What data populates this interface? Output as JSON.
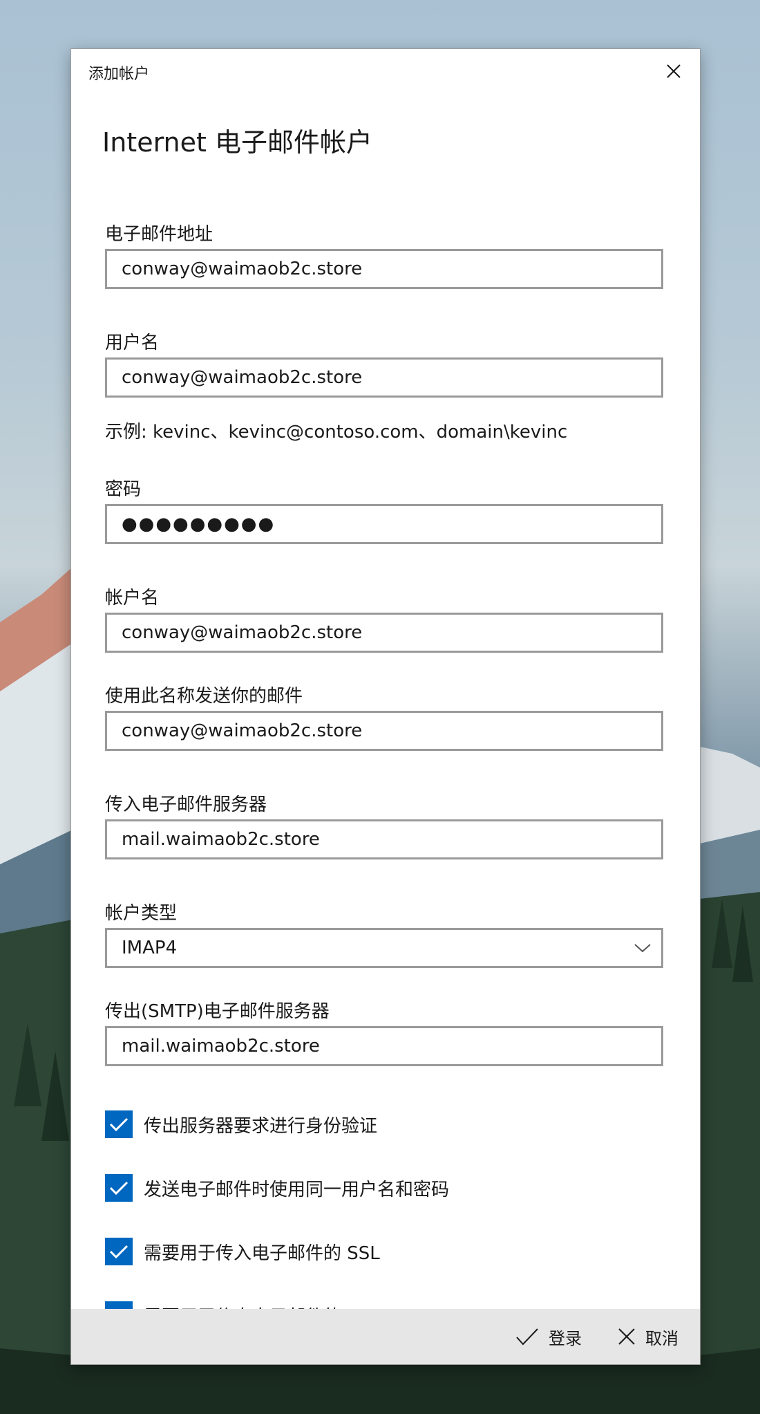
{
  "window": {
    "title": "添加帐户",
    "heading": "Internet 电子邮件帐户"
  },
  "fields": {
    "email": {
      "label": "电子邮件地址",
      "value": "conway@waimaob2c.store"
    },
    "username": {
      "label": "用户名",
      "value": "conway@waimaob2c.store",
      "hint": "示例: kevinc、kevinc@contoso.com、domain\\kevinc"
    },
    "password": {
      "label": "密码",
      "value": "●●●●●●●●●"
    },
    "account_name": {
      "label": "帐户名",
      "value": "conway@waimaob2c.store"
    },
    "send_name": {
      "label": "使用此名称发送你的邮件",
      "value": "conway@waimaob2c.store"
    },
    "incoming_server": {
      "label": "传入电子邮件服务器",
      "value": "mail.waimaob2c.store"
    },
    "account_type": {
      "label": "帐户类型",
      "value": "IMAP4"
    },
    "outgoing_server": {
      "label": "传出(SMTP)电子邮件服务器",
      "value": "mail.waimaob2c.store"
    }
  },
  "checkboxes": [
    {
      "label": "传出服务器要求进行身份验证",
      "checked": true
    },
    {
      "label": "发送电子邮件时使用同一用户名和密码",
      "checked": true
    },
    {
      "label": "需要用于传入电子邮件的 SSL",
      "checked": true
    },
    {
      "label": "需要用于传出电子邮件的 SSL",
      "checked": true
    }
  ],
  "footer": {
    "signin_label": "登录",
    "cancel_label": "取消"
  },
  "colors": {
    "accent": "#0067c0",
    "field_border": "#9a9a9a",
    "footer_bg": "#e6e6e6"
  },
  "icons": [
    "close-icon",
    "chevron-down-icon",
    "checkmark-icon",
    "cancel-icon"
  ]
}
